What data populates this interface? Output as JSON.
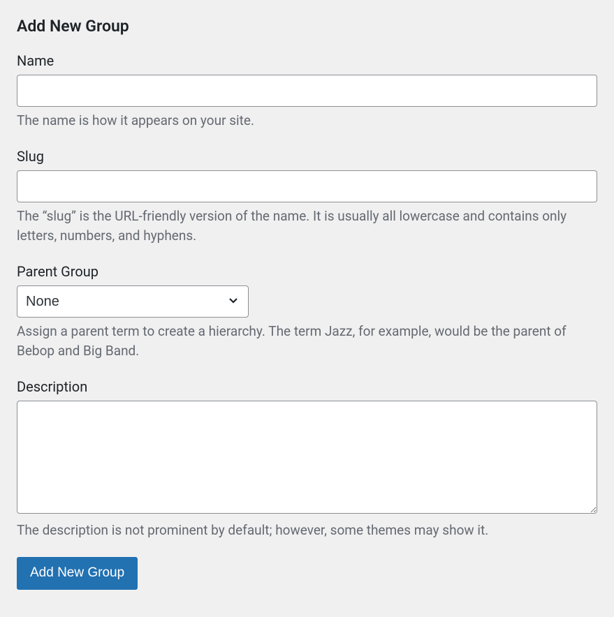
{
  "form": {
    "heading": "Add New Group",
    "fields": {
      "name": {
        "label": "Name",
        "value": "",
        "helper": "The name is how it appears on your site."
      },
      "slug": {
        "label": "Slug",
        "value": "",
        "helper": "The “slug” is the URL-friendly version of the name. It is usually all lowercase and contains only letters, numbers, and hyphens."
      },
      "parent": {
        "label": "Parent Group",
        "selected": "None",
        "helper": "Assign a parent term to create a hierarchy. The term Jazz, for example, would be the parent of Bebop and Big Band."
      },
      "description": {
        "label": "Description",
        "value": "",
        "helper": "The description is not prominent by default; however, some themes may show it."
      }
    },
    "submit_label": "Add New Group"
  }
}
